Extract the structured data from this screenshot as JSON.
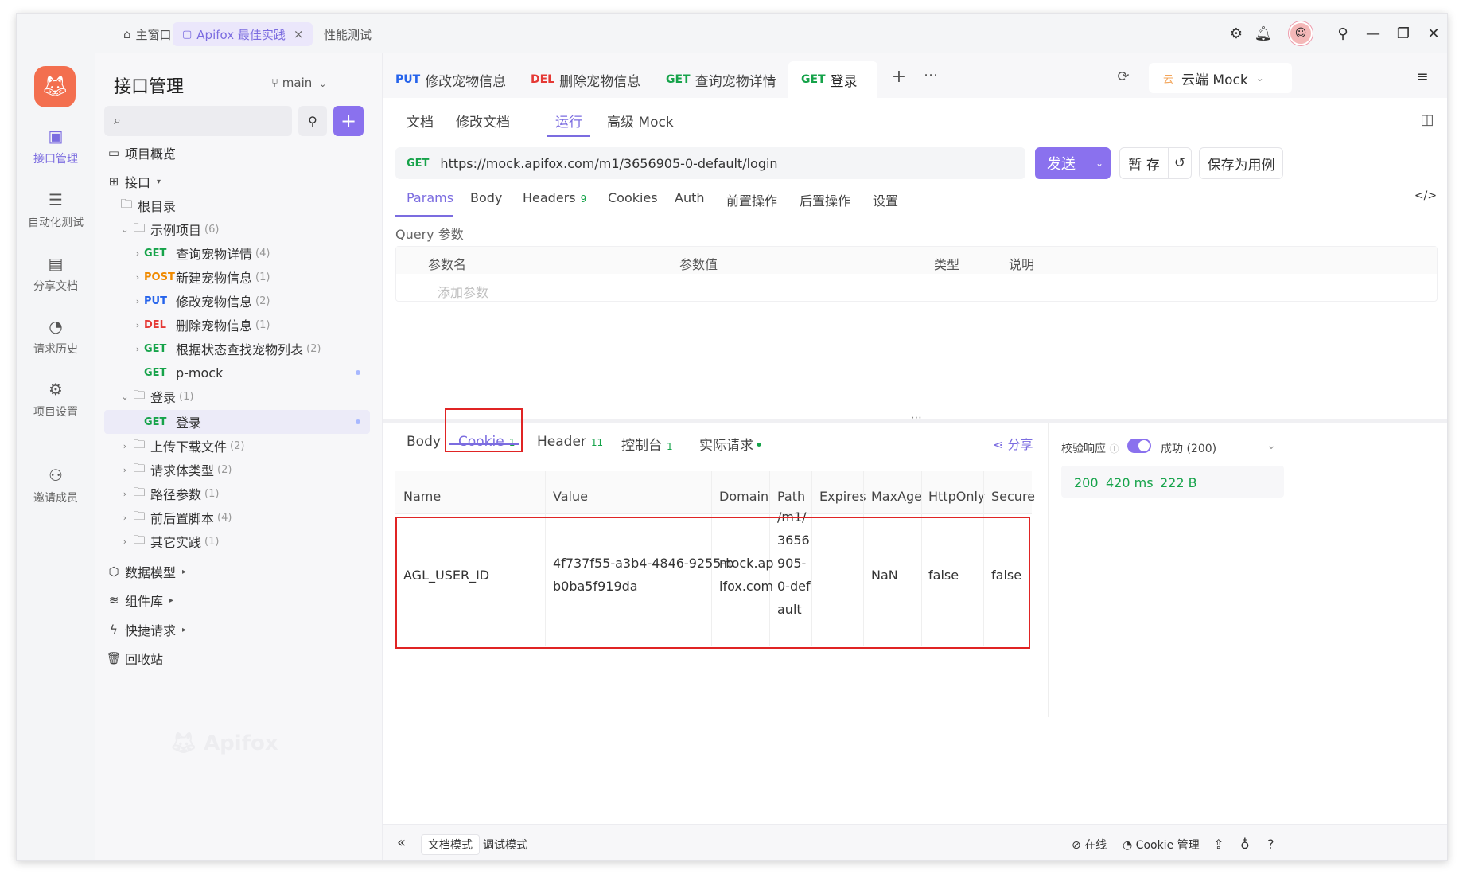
{
  "titlebar": {
    "tabs": [
      {
        "label": "主窗口",
        "icon": "home-icon"
      },
      {
        "label": "Apifox 最佳实践",
        "icon": "document-icon",
        "close": "×"
      },
      {
        "label": "性能测试"
      }
    ]
  },
  "rail": {
    "items": [
      {
        "label": "接口管理",
        "icon": "api-management-icon",
        "active": true
      },
      {
        "label": "自动化测试",
        "icon": "automation-icon"
      },
      {
        "label": "分享文档",
        "icon": "share-doc-icon"
      },
      {
        "label": "请求历史",
        "icon": "history-icon"
      },
      {
        "label": "项目设置",
        "icon": "project-settings-icon"
      },
      {
        "label": "邀请成员",
        "icon": "invite-member-icon"
      }
    ]
  },
  "sidebar": {
    "title": "接口管理",
    "branch": "main",
    "tree": [
      {
        "label": "项目概览",
        "type": "overview"
      },
      {
        "label": "接口",
        "type": "section"
      },
      {
        "label": "根目录",
        "type": "folder"
      },
      {
        "label": "示例项目",
        "count": "(6)",
        "type": "folder"
      },
      {
        "method": "GET",
        "label": "查询宠物详情",
        "count": "(4)"
      },
      {
        "method": "POST",
        "label": "新建宠物信息",
        "count": "(1)"
      },
      {
        "method": "PUT",
        "label": "修改宠物信息",
        "count": "(2)"
      },
      {
        "method": "DEL",
        "label": "删除宠物信息",
        "count": "(1)"
      },
      {
        "method": "GET",
        "label": "根据状态查找宠物列表",
        "count": "(2)"
      },
      {
        "method": "GET",
        "label": "p-mock",
        "count": ""
      },
      {
        "label": "登录",
        "count": "(1)",
        "type": "folder"
      },
      {
        "method": "GET",
        "label": "登录",
        "count": ""
      },
      {
        "label": "上传下载文件",
        "count": "(2)",
        "type": "folder"
      },
      {
        "label": "请求体类型",
        "count": "(2)",
        "type": "folder"
      },
      {
        "label": "路径参数",
        "count": "(1)",
        "type": "folder"
      },
      {
        "label": "前后置脚本",
        "count": "(4)",
        "type": "folder"
      },
      {
        "label": "其它实践",
        "count": "(1)",
        "type": "folder"
      },
      {
        "label": "数据模型",
        "type": "section"
      },
      {
        "label": "组件库",
        "type": "section"
      },
      {
        "label": "快捷请求",
        "type": "section"
      },
      {
        "label": "回收站",
        "type": "section"
      }
    ],
    "watermark": "Apifox"
  },
  "request_tabs": [
    {
      "method": "PUT",
      "label": "修改宠物信息"
    },
    {
      "method": "DEL",
      "label": "删除宠物信息"
    },
    {
      "method": "GET",
      "label": "查询宠物详情"
    },
    {
      "method": "GET",
      "label": "登录",
      "active": true
    }
  ],
  "env": {
    "label": "云端 Mock",
    "icon_text": "云"
  },
  "subtabs": [
    "文档",
    "修改文档",
    "运行",
    "高级 Mock"
  ],
  "url": {
    "method": "GET",
    "value": "https://mock.apifox.com/m1/3656905-0-default/login"
  },
  "actions": {
    "send": "发送",
    "save_draft": "暂 存",
    "save_case": "保存为用例"
  },
  "param_tabs": [
    {
      "label": "Params",
      "active": true
    },
    {
      "label": "Body"
    },
    {
      "label": "Headers",
      "count": "9"
    },
    {
      "label": "Cookies"
    },
    {
      "label": "Auth"
    },
    {
      "label": "前置操作"
    },
    {
      "label": "后置操作"
    },
    {
      "label": "设置"
    }
  ],
  "query": {
    "label": "Query 参数",
    "columns": [
      "参数名",
      "参数值",
      "类型",
      "说明"
    ],
    "placeholder": "添加参数"
  },
  "response_tabs": [
    {
      "label": "Body"
    },
    {
      "label": "Cookie",
      "count": "1",
      "active": true
    },
    {
      "label": "Header",
      "count": "11"
    },
    {
      "label": "控制台",
      "count": "1"
    },
    {
      "label": "实际请求",
      "dot": "•"
    }
  ],
  "share_label": "分享",
  "cookie_table": {
    "columns": [
      "Name",
      "Value",
      "Domain",
      "Path",
      "Expires",
      "MaxAge",
      "HttpOnly",
      "Secure"
    ],
    "row": {
      "name": "AGL_USER_ID",
      "value": [
        "4f737f55-a3b4-4846-9255-b",
        "b0ba5f919da"
      ],
      "domain": [
        "mock.ap",
        "ifox.com"
      ],
      "path": [
        "/m1/",
        "3656",
        "905-",
        "0-def",
        "ault"
      ],
      "expires": "",
      "maxage": "NaN",
      "httponly": "false",
      "secure": "false"
    }
  },
  "verify": {
    "label": "校验响应",
    "status": "成功 (200)"
  },
  "stats": {
    "code": "200",
    "time": "420 ms",
    "size": "222 B"
  },
  "bottombar": {
    "modes": [
      "文档模式",
      "调试模式"
    ],
    "online": "在线",
    "cookie_manage": "Cookie 管理"
  }
}
